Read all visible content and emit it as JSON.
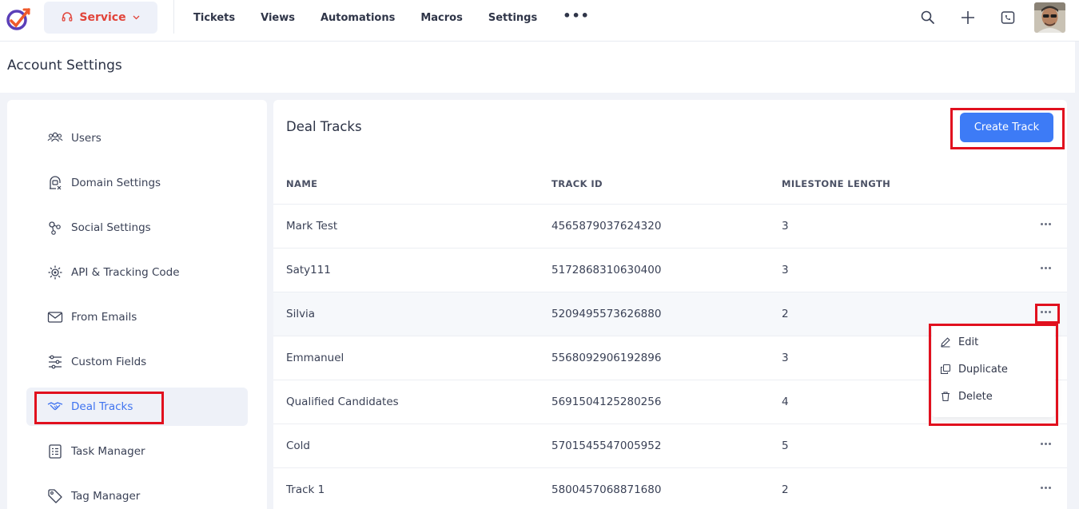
{
  "header": {
    "service_label": "Service",
    "nav": [
      "Tickets",
      "Views",
      "Automations",
      "Macros",
      "Settings"
    ],
    "more_glyph": "•••"
  },
  "page_title": "Account Settings",
  "sidebar": {
    "items": [
      {
        "label": "Users",
        "icon": "users-icon"
      },
      {
        "label": "Domain Settings",
        "icon": "domain-settings-icon"
      },
      {
        "label": "Social Settings",
        "icon": "share-icon"
      },
      {
        "label": "API & Tracking Code",
        "icon": "api-gear-icon"
      },
      {
        "label": "From Emails",
        "icon": "envelope-icon"
      },
      {
        "label": "Custom Fields",
        "icon": "sliders-icon"
      },
      {
        "label": "Deal Tracks",
        "icon": "handshake-icon",
        "active": true
      },
      {
        "label": "Task Manager",
        "icon": "checklist-icon"
      },
      {
        "label": "Tag Manager",
        "icon": "tag-icon"
      }
    ]
  },
  "main": {
    "title": "Deal Tracks",
    "create_label": "Create Track",
    "columns": [
      "NAME",
      "TRACK ID",
      "MILESTONE LENGTH"
    ],
    "rows": [
      {
        "name": "Mark Test",
        "id": "4565879037624320",
        "len": "3"
      },
      {
        "name": "Saty111",
        "id": "5172868310630400",
        "len": "3"
      },
      {
        "name": "Silvia",
        "id": "5209495573626880",
        "len": "2"
      },
      {
        "name": "Emmanuel",
        "id": "5568092906192896",
        "len": "3"
      },
      {
        "name": "Qualified Candidates",
        "id": "5691504125280256",
        "len": "4"
      },
      {
        "name": "Cold",
        "id": "5701545547005952",
        "len": "5"
      },
      {
        "name": "Track 1",
        "id": "5800457068871680",
        "len": "2"
      }
    ]
  },
  "menu": {
    "edit": "Edit",
    "duplicate": "Duplicate",
    "delete": "Delete"
  },
  "colors": {
    "accent": "#3d7bf6",
    "brand_red": "#e1443a",
    "highlight_red": "#e1101e"
  }
}
